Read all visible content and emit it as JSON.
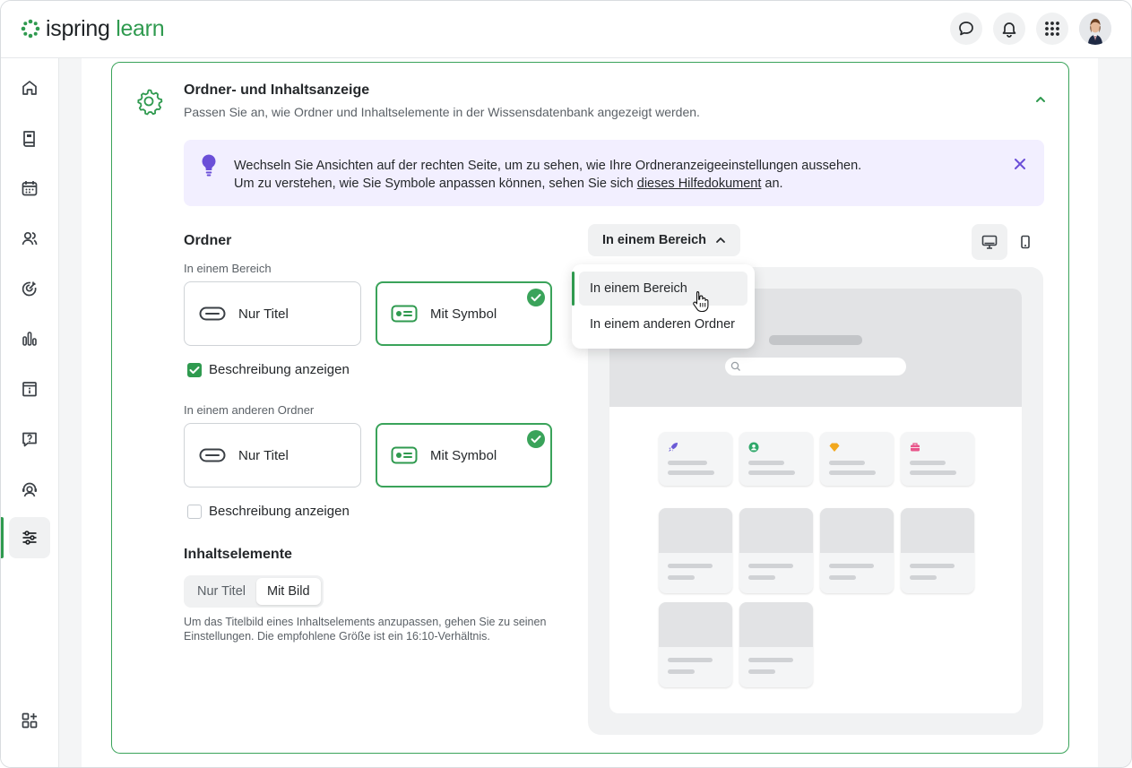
{
  "brand": {
    "name_part1": "ispring",
    "name_part2": "learn",
    "accent": "#2f9a4f"
  },
  "topbar": {
    "icons": [
      "chat-icon",
      "bell-icon",
      "apps-grid-icon"
    ],
    "avatar": "user-avatar"
  },
  "sidebar": {
    "items": [
      "home",
      "library",
      "calendar",
      "users",
      "goals",
      "reports",
      "info-board",
      "help",
      "supervisor",
      "settings"
    ],
    "active": "settings",
    "bottom": "add-apps"
  },
  "panel": {
    "title": "Ordner- und Inhaltsanzeige",
    "subtitle": "Passen Sie an, wie Ordner und Inhaltselemente in der Wissensdatenbank angezeigt werden."
  },
  "info": {
    "line1": "Wechseln Sie Ansichten auf der rechten Seite, um zu sehen, wie Ihre Ordneranzeigeeinstellungen aussehen.",
    "line2_before": "Um zu verstehen, wie Sie Symbole anpassen können, sehen Sie sich ",
    "line2_link": "dieses Hilfedokument",
    "line2_after": " an."
  },
  "folders": {
    "title": "Ordner",
    "group1": {
      "label": "In einem Bereich",
      "opt1": "Nur Titel",
      "opt2": "Mit Symbol",
      "selected": "Mit Symbol",
      "checkbox_label": "Beschreibung anzeigen",
      "checked": true
    },
    "group2": {
      "label": "In einem anderen Ordner",
      "opt1": "Nur Titel",
      "opt2": "Mit Symbol",
      "selected": "Mit Symbol",
      "checkbox_label": "Beschreibung anzeigen",
      "checked": false
    }
  },
  "content_items": {
    "title": "Inhaltselemente",
    "tab1": "Nur Titel",
    "tab2": "Mit Bild",
    "selected": "Mit Bild",
    "hint": "Um das Titelbild eines Inhaltselements anzupassen, gehen Sie zu seinen Einstellungen. Die empfohlene Größe ist ein 16:10-Verhältnis."
  },
  "view_dropdown": {
    "value": "In einem Bereich",
    "options": [
      "In einem Bereich",
      "In einem anderen Ordner"
    ],
    "selected_index": 0
  },
  "devices": {
    "selected": "desktop",
    "options": [
      "desktop",
      "mobile"
    ]
  },
  "preview_card_icon_colors": [
    "#6b5bd6",
    "#2fa86a",
    "#f2a81d",
    "#e8558a"
  ]
}
